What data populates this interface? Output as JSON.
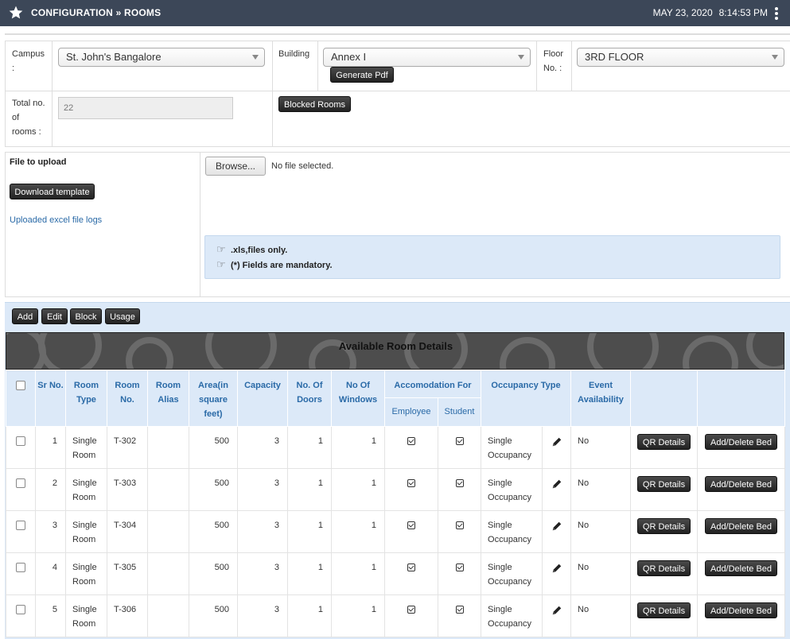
{
  "header": {
    "title": "CONFIGURATION » ROOMS",
    "date": "MAY 23, 2020",
    "time": "8:14:53 PM"
  },
  "filters": {
    "campus_label": "Campus :",
    "campus_value": "St. John's Bangalore",
    "building_label": "Building",
    "building_value": "Annex I",
    "generate_pdf": "Generate Pdf",
    "floor_label": "Floor No. :",
    "floor_value": "3RD FLOOR",
    "total_label": "Total no. of rooms :",
    "total_value": "22",
    "blocked_rooms": "Blocked Rooms"
  },
  "upload": {
    "file_label": "File to upload",
    "download_template": "Download template",
    "logs_link": "Uploaded excel file logs",
    "browse": "Browse...",
    "no_file": "No file selected.",
    "note1": ".xls,files only.",
    "note2": "(*) Fields are mandatory."
  },
  "toolbar": {
    "add": "Add",
    "edit": "Edit",
    "block": "Block",
    "usage": "Usage"
  },
  "table": {
    "title": "Available Room Details",
    "headers": {
      "sr": "Sr No.",
      "room_type": "Room Type",
      "room_no": "Room No.",
      "room_alias": "Room Alias",
      "area": "Area(in square feet)",
      "capacity": "Capacity",
      "doors": "No. Of Doors",
      "windows": "No Of Windows",
      "accomodation": "Accomodation For",
      "employee": "Employee",
      "student": "Student",
      "occupancy": "Occupancy Type",
      "event": "Event Availability"
    },
    "rows": [
      {
        "sr": "1",
        "type": "Single Room",
        "no": "T-302",
        "alias": "",
        "area": "500",
        "capacity": "3",
        "doors": "1",
        "windows": "1",
        "occupancy": "Single Occupancy",
        "event": "No",
        "qr": "QR Details",
        "bed": "Add/Delete Bed"
      },
      {
        "sr": "2",
        "type": "Single Room",
        "no": "T-303",
        "alias": "",
        "area": "500",
        "capacity": "3",
        "doors": "1",
        "windows": "1",
        "occupancy": "Single Occupancy",
        "event": "No",
        "qr": "QR Details",
        "bed": "Add/Delete Bed"
      },
      {
        "sr": "3",
        "type": "Single Room",
        "no": "T-304",
        "alias": "",
        "area": "500",
        "capacity": "3",
        "doors": "1",
        "windows": "1",
        "occupancy": "Single Occupancy",
        "event": "No",
        "qr": "QR Details",
        "bed": "Add/Delete Bed"
      },
      {
        "sr": "4",
        "type": "Single Room",
        "no": "T-305",
        "alias": "",
        "area": "500",
        "capacity": "3",
        "doors": "1",
        "windows": "1",
        "occupancy": "Single Occupancy",
        "event": "No",
        "qr": "QR Details",
        "bed": "Add/Delete Bed"
      },
      {
        "sr": "5",
        "type": "Single Room",
        "no": "T-306",
        "alias": "",
        "area": "500",
        "capacity": "3",
        "doors": "1",
        "windows": "1",
        "occupancy": "Single Occupancy",
        "event": "No",
        "qr": "QR Details",
        "bed": "Add/Delete Bed"
      }
    ]
  }
}
